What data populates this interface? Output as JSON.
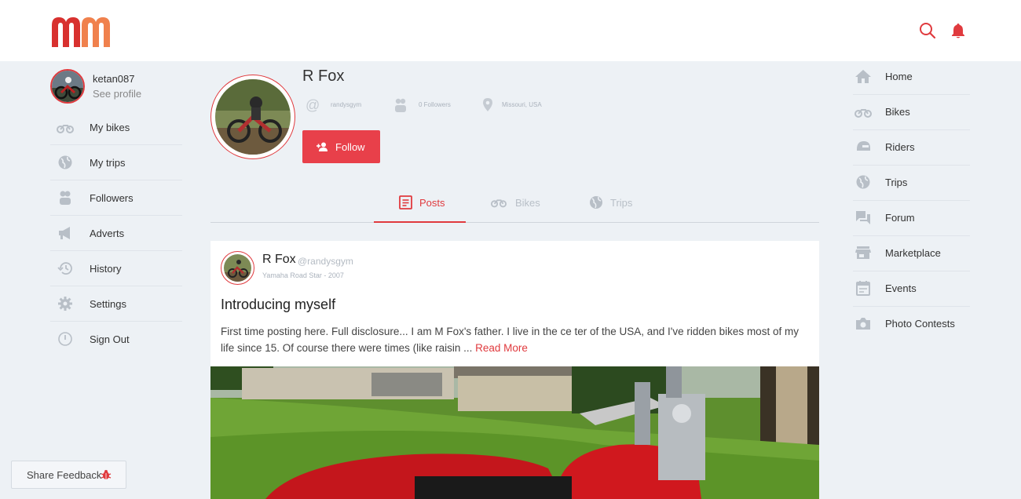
{
  "header": {
    "logo_alt": "mm",
    "search_icon": "search-icon",
    "bell_icon": "bell-icon"
  },
  "me": {
    "username": "ketan087",
    "see_profile": "See profile"
  },
  "left_nav": {
    "items": [
      {
        "label": "My bikes",
        "icon": "bike-icon"
      },
      {
        "label": "My trips",
        "icon": "globe-icon"
      },
      {
        "label": "Followers",
        "icon": "people-icon"
      },
      {
        "label": "Adverts",
        "icon": "megaphone-icon"
      },
      {
        "label": "History",
        "icon": "history-icon"
      },
      {
        "label": "Settings",
        "icon": "gear-icon"
      },
      {
        "label": "Sign Out",
        "icon": "power-icon"
      }
    ]
  },
  "feedback": {
    "label": "Share Feedback",
    "icon": "bug-icon"
  },
  "profile": {
    "name": "R Fox",
    "handle": "randysgym",
    "followers": "0 Followers",
    "location": "Missouri, USA",
    "follow_label": "Follow"
  },
  "tabs": [
    {
      "label": "Posts",
      "icon": "document-icon",
      "active": true
    },
    {
      "label": "Bikes",
      "icon": "bike-icon",
      "active": false
    },
    {
      "label": "Trips",
      "icon": "globe-icon",
      "active": false
    }
  ],
  "post": {
    "author": "R Fox",
    "handle": "@randysgym",
    "bike": "Yamaha Road Star - 2007",
    "title": "Introducing myself",
    "body": "First time posting here. Full disclosure... I am M Fox's father. I live in the ce ter of the USA, and I've ridden bikes most of my life since 15. Of course there were times (like raisin ... ",
    "read_more": "Read More"
  },
  "right_nav": {
    "items": [
      {
        "label": "Home",
        "icon": "home-icon"
      },
      {
        "label": "Bikes",
        "icon": "bike-icon"
      },
      {
        "label": "Riders",
        "icon": "helmet-icon"
      },
      {
        "label": "Trips",
        "icon": "globe-icon"
      },
      {
        "label": "Forum",
        "icon": "chat-icon"
      },
      {
        "label": "Marketplace",
        "icon": "store-icon"
      },
      {
        "label": "Events",
        "icon": "calendar-icon"
      },
      {
        "label": "Photo Contests",
        "icon": "camera-icon"
      }
    ]
  },
  "colors": {
    "accent": "#e03a3e",
    "background": "#edf1f5",
    "icon_gray": "#b8bfc7"
  }
}
